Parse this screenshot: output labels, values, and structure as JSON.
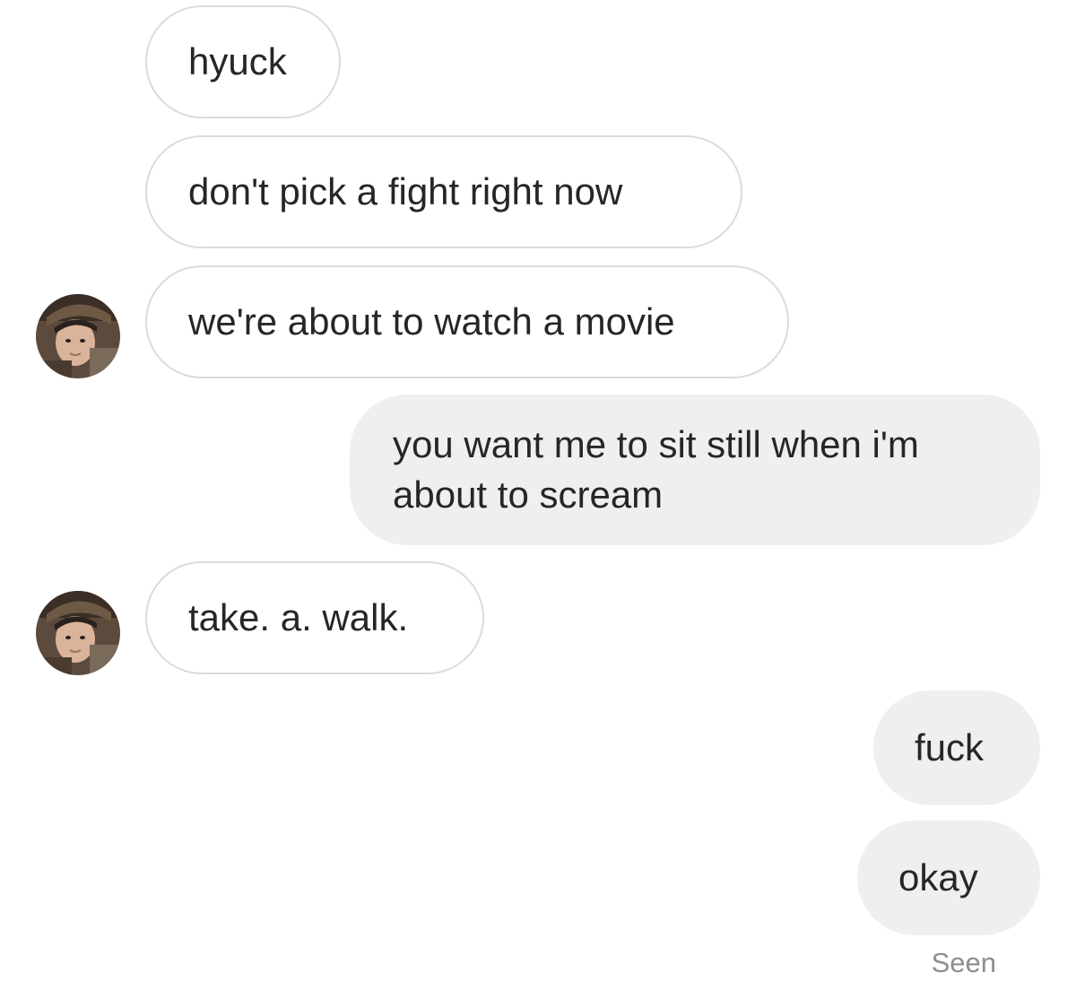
{
  "messages": [
    {
      "side": "incoming",
      "text": "hyuck"
    },
    {
      "side": "incoming",
      "text": "don't pick a fight right now"
    },
    {
      "side": "incoming",
      "text": "we're about to watch a movie"
    },
    {
      "side": "outgoing",
      "text": "you want me to sit still when i'm about to scream"
    },
    {
      "side": "incoming",
      "text": "take. a. walk."
    },
    {
      "side": "outgoing",
      "text": "fuck"
    },
    {
      "side": "outgoing",
      "text": "okay"
    }
  ],
  "status": "Seen",
  "colors": {
    "incoming_bg": "#ffffff",
    "incoming_border": "#dbdbdb",
    "outgoing_bg": "#efefef",
    "text": "#262626",
    "status_text": "#8e8e8e"
  },
  "icons": {
    "avatar": "profile-photo"
  }
}
